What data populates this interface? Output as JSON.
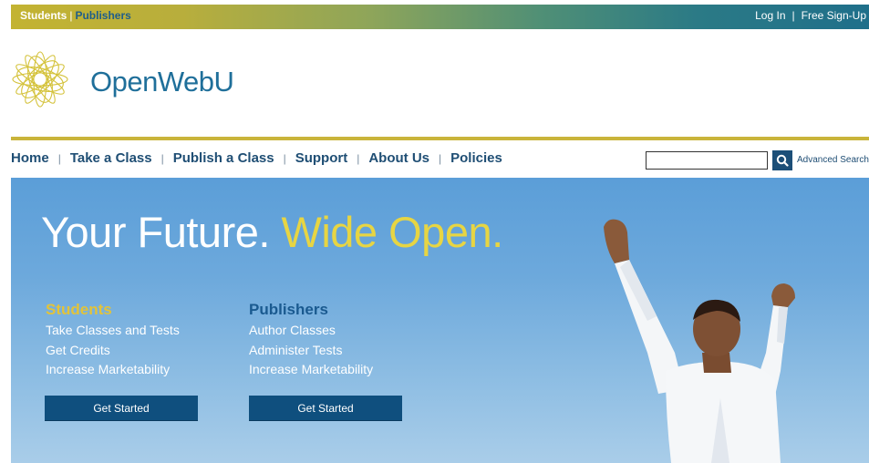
{
  "topbar": {
    "students": "Students",
    "separator": "|",
    "publishers": "Publishers",
    "login": "Log In",
    "right_separator": "|",
    "signup": "Free Sign-Up"
  },
  "brand": {
    "name": "OpenWebU"
  },
  "nav": {
    "items": [
      "Home",
      "Take a Class",
      "Publish a Class",
      "Support",
      "About Us",
      "Policies"
    ],
    "divider": "|"
  },
  "search": {
    "value": "",
    "advanced_label": "Advanced Search"
  },
  "hero": {
    "headline_main": "Your Future.",
    "headline_accent": "Wide Open.",
    "students": {
      "heading": "Students",
      "lines": [
        "Take Classes and Tests",
        "Get Credits",
        "Increase Marketability"
      ],
      "button": "Get Started"
    },
    "publishers": {
      "heading": "Publishers",
      "lines": [
        "Author Classes",
        "Administer Tests",
        "Increase Marketability"
      ],
      "button": "Get Started"
    }
  },
  "colors": {
    "gold": "#c9b43a",
    "navy": "#1f4e74",
    "brand_blue": "#1f6f9a",
    "button": "#0f4f7e",
    "sky": "#6da9dc"
  }
}
